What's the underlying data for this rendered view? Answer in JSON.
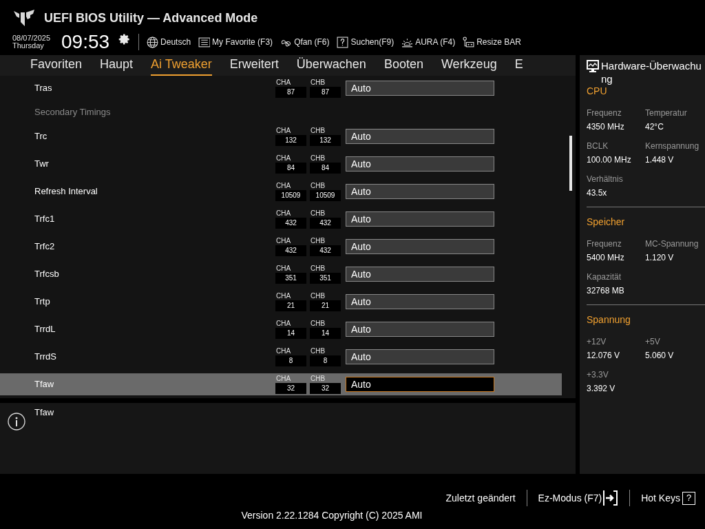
{
  "header": {
    "title": "UEFI BIOS Utility — Advanced Mode",
    "date": "08/07/2025",
    "day": "Thursday",
    "time": "09:53",
    "toolbar": [
      {
        "label": "Deutsch"
      },
      {
        "label": "My Favorite (F3)"
      },
      {
        "label": "Qfan (F6)"
      },
      {
        "label": "Suchen(F9)"
      },
      {
        "label": "AURA (F4)"
      },
      {
        "label": "Resize BAR"
      }
    ]
  },
  "tabs": [
    {
      "label": "Favoriten",
      "selected": false
    },
    {
      "label": "Haupt",
      "selected": false
    },
    {
      "label": "Ai Tweaker",
      "selected": true
    },
    {
      "label": "Erweitert",
      "selected": false
    },
    {
      "label": "Überwachen",
      "selected": false
    },
    {
      "label": "Booten",
      "selected": false
    },
    {
      "label": "Werkzeug",
      "selected": false
    },
    {
      "label": "E",
      "selected": false
    }
  ],
  "settings": [
    {
      "kind": "setting",
      "label": "Tras",
      "channels": [
        {
          "label": "CHA",
          "value": "87"
        },
        {
          "label": "CHB",
          "value": "87"
        }
      ],
      "value": "Auto",
      "selected": false
    },
    {
      "kind": "heading",
      "label": "Secondary Timings"
    },
    {
      "kind": "setting",
      "label": "Trc",
      "channels": [
        {
          "label": "CHA",
          "value": "132"
        },
        {
          "label": "CHB",
          "value": "132"
        }
      ],
      "value": "Auto",
      "selected": false
    },
    {
      "kind": "setting",
      "label": "Twr",
      "channels": [
        {
          "label": "CHA",
          "value": "84"
        },
        {
          "label": "CHB",
          "value": "84"
        }
      ],
      "value": "Auto",
      "selected": false
    },
    {
      "kind": "setting",
      "label": "Refresh Interval",
      "channels": [
        {
          "label": "CHA",
          "value": "10509"
        },
        {
          "label": "CHB",
          "value": "10509"
        }
      ],
      "value": "Auto",
      "selected": false
    },
    {
      "kind": "setting",
      "label": "Trfc1",
      "channels": [
        {
          "label": "CHA",
          "value": "432"
        },
        {
          "label": "CHB",
          "value": "432"
        }
      ],
      "value": "Auto",
      "selected": false
    },
    {
      "kind": "setting",
      "label": "Trfc2",
      "channels": [
        {
          "label": "CHA",
          "value": "432"
        },
        {
          "label": "CHB",
          "value": "432"
        }
      ],
      "value": "Auto",
      "selected": false
    },
    {
      "kind": "setting",
      "label": "Trfcsb",
      "channels": [
        {
          "label": "CHA",
          "value": "351"
        },
        {
          "label": "CHB",
          "value": "351"
        }
      ],
      "value": "Auto",
      "selected": false
    },
    {
      "kind": "setting",
      "label": "Trtp",
      "channels": [
        {
          "label": "CHA",
          "value": "21"
        },
        {
          "label": "CHB",
          "value": "21"
        }
      ],
      "value": "Auto",
      "selected": false
    },
    {
      "kind": "setting",
      "label": "TrrdL",
      "channels": [
        {
          "label": "CHA",
          "value": "14"
        },
        {
          "label": "CHB",
          "value": "14"
        }
      ],
      "value": "Auto",
      "selected": false
    },
    {
      "kind": "setting",
      "label": "TrrdS",
      "channels": [
        {
          "label": "CHA",
          "value": "8"
        },
        {
          "label": "CHB",
          "value": "8"
        }
      ],
      "value": "Auto",
      "selected": false
    },
    {
      "kind": "setting",
      "label": "Tfaw",
      "channels": [
        {
          "label": "CHA",
          "value": "32"
        },
        {
          "label": "CHB",
          "value": "32"
        }
      ],
      "value": "Auto",
      "selected": true
    }
  ],
  "help": {
    "text": "Tfaw"
  },
  "monitor": {
    "title": "Hardware-Überwachung",
    "sections": [
      {
        "title": "CPU",
        "items": [
          {
            "label": "Frequenz",
            "value": "4350 MHz"
          },
          {
            "label": "Temperatur",
            "value": "42°C"
          },
          {
            "label": "BCLK",
            "value": "100.00 MHz"
          },
          {
            "label": "Kernspannung",
            "value": "1.448 V"
          },
          {
            "label": "Verhältnis",
            "value": "43.5x"
          }
        ]
      },
      {
        "title": "Speicher",
        "items": [
          {
            "label": "Frequenz",
            "value": "5400 MHz"
          },
          {
            "label": "MC-Spannung",
            "value": "1.120 V"
          },
          {
            "label": "Kapazität",
            "value": "32768 MB"
          }
        ]
      },
      {
        "title": "Spannung",
        "items": [
          {
            "label": "+12V",
            "value": "12.076 V"
          },
          {
            "label": "+5V",
            "value": "5.060 V"
          },
          {
            "label": "+3.3V",
            "value": "3.392 V"
          }
        ]
      }
    ]
  },
  "footer": {
    "last_changed": "Zuletzt geändert",
    "ez_mode": "Ez-Modus (F7)",
    "hot_keys": "Hot Keys",
    "hot_keys_icon": "?",
    "version": "Version 2.22.1284 Copyright (C) 2025 AMI"
  }
}
